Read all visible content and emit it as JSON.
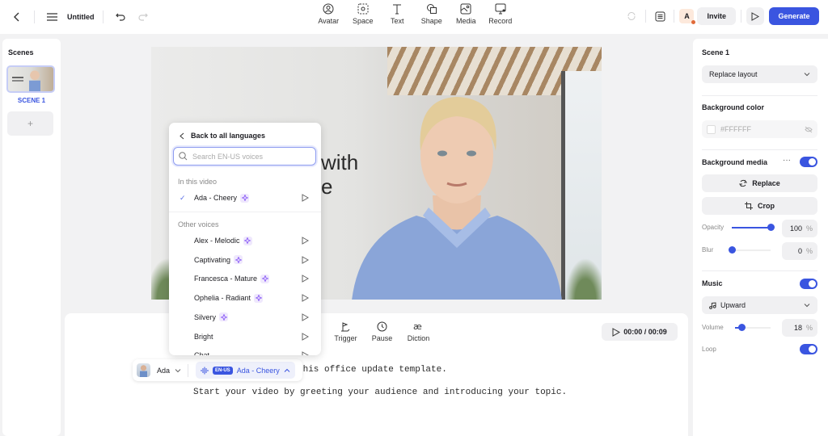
{
  "topbar": {
    "title": "Untitled",
    "tools": [
      {
        "label": "Avatar",
        "icon": "avatar-icon"
      },
      {
        "label": "Space",
        "icon": "space-icon"
      },
      {
        "label": "Text",
        "icon": "text-icon"
      },
      {
        "label": "Shape",
        "icon": "shape-icon"
      },
      {
        "label": "Media",
        "icon": "media-icon"
      },
      {
        "label": "Record",
        "icon": "record-icon"
      }
    ],
    "user_initial": "A",
    "invite_label": "Invite",
    "generate_label": "Generate"
  },
  "scenes": {
    "heading": "Scenes",
    "items": [
      {
        "label": "SCENE 1"
      }
    ],
    "add_label": "+"
  },
  "canvas": {
    "hero_line1": "with",
    "hero_line2": "e"
  },
  "voice_dropdown": {
    "back_label": "Back to all languages",
    "search_placeholder": "Search EN-US voices",
    "search_value": "",
    "section_current": "In this video",
    "current_voice": {
      "name": "Ada - Cheery",
      "premium": true,
      "selected": true
    },
    "section_other": "Other voices",
    "other_voices": [
      {
        "name": "Alex - Melodic",
        "premium": true
      },
      {
        "name": "Captivating",
        "premium": true
      },
      {
        "name": "Francesca - Mature",
        "premium": true
      },
      {
        "name": "Ophelia - Radiant",
        "premium": true
      },
      {
        "name": "Silvery",
        "premium": true
      },
      {
        "name": "Bright",
        "premium": false
      },
      {
        "name": "Chat",
        "premium": false
      }
    ]
  },
  "editor": {
    "tools": [
      {
        "label": "Trigger",
        "icon": "trigger-icon"
      },
      {
        "label": "Pause",
        "icon": "clock-icon"
      },
      {
        "label": "Diction",
        "icon": "diction-icon"
      }
    ],
    "timer": "00:00 / 00:09",
    "voicebar": {
      "avatar_name": "Ada",
      "language_badge": "EN-US",
      "voice_name": "Ada - Cheery"
    },
    "script_lines": [
      "this office update template.",
      "Start your video by greeting your audience and introducing your topic."
    ]
  },
  "right_panel": {
    "scene_title": "Scene 1",
    "layout_select": "Replace layout",
    "background_color_label": "Background color",
    "background_color_value": "#FFFFFF",
    "background_media_label": "Background media",
    "background_media_enabled": true,
    "replace_label": "Replace",
    "crop_label": "Crop",
    "opacity_label": "Opacity",
    "opacity_value": "100",
    "opacity_fraction": 1.0,
    "blur_label": "Blur",
    "blur_value": "0",
    "blur_fraction": 0.0,
    "percent_unit": "%",
    "music_label": "Music",
    "music_enabled": true,
    "music_track": "Upward",
    "volume_label": "Volume",
    "volume_value": "18",
    "volume_fraction": 0.18,
    "loop_label": "Loop",
    "loop_enabled": true
  },
  "colors": {
    "accent": "#3a55e0",
    "premium_sparkle": "#8b5cf6"
  }
}
